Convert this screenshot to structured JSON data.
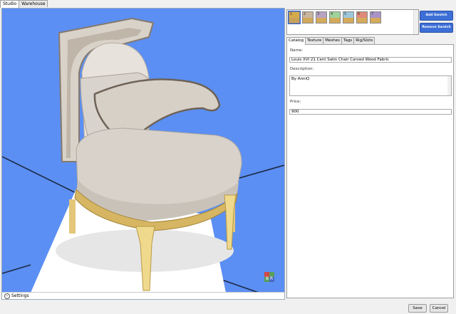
{
  "tabs": {
    "studio": "Studio",
    "warehouse": "Warehouse"
  },
  "viewport": {
    "settings_label": "Settings",
    "logo_text": "B R",
    "background": "#5b8ff3"
  },
  "swatches": [
    {
      "num": "1",
      "top": "#d6ab4d",
      "bot": "#c8a15a",
      "selected": true
    },
    {
      "num": "2",
      "top": "#c9b49e",
      "bot": "#d2a95a"
    },
    {
      "num": "3",
      "top": "#b7a3c2",
      "bot": "#d4aa5b"
    },
    {
      "num": "4",
      "top": "#9fd39a",
      "bot": "#d4aa5b"
    },
    {
      "num": "5",
      "top": "#9cc7dc",
      "bot": "#d4aa5b"
    },
    {
      "num": "6",
      "top": "#e08a7a",
      "bot": "#d4aa5b"
    },
    {
      "num": "7",
      "top": "#a993c9",
      "bot": "#d4aa5b"
    }
  ],
  "buttons": {
    "add_swatch": "Add Swatch",
    "remove_swatch": "Remove Swatch",
    "save": "Save",
    "cancel": "Cancel"
  },
  "prop_tabs": [
    "Catalog",
    "Texture",
    "Meshes",
    "Tags",
    "Rig/Slots"
  ],
  "catalog": {
    "name_label": "Name:",
    "name_value": "Louis XVI 21 Cent Satin Chair Carved Wood Fabric",
    "description_label": "Description:",
    "description_value": "By AnniQ",
    "price_label": "Price:",
    "price_value": "900"
  }
}
